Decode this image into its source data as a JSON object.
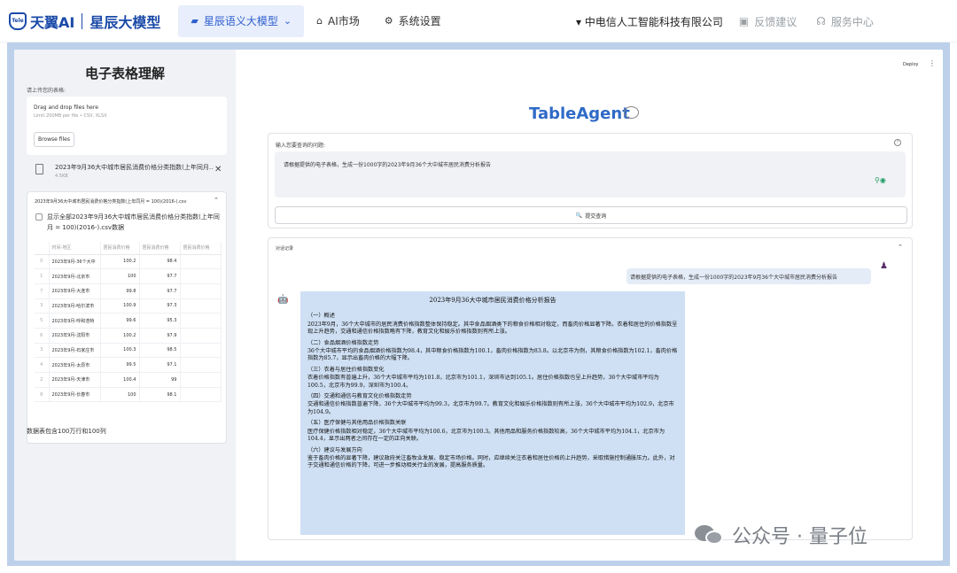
{
  "nav": {
    "brand": "天翼AI",
    "brand2": "星辰大模型",
    "active_tab": "星辰语义大模型",
    "tabs": [
      "AI市场",
      "系统设置"
    ],
    "company": "中电信人工智能科技有限公司",
    "links": [
      "反馈建议",
      "服务中心"
    ]
  },
  "sidebar": {
    "title": "电子表格理解",
    "prompt": "请上传您的表格:",
    "uploader": {
      "drag_text": "Drag and drop files here",
      "limit_text": "Limit 200MB per file • CSV, XLSX",
      "browse_label": "Browse files"
    },
    "file": {
      "name": "2023年9月36大中城市居民消费价格分类指数(上年同月...",
      "size": "4.5KB"
    },
    "expander": {
      "title": "2023年9月36大中城市居民消费价格分类指数(上年同月 = 100)(2016-).csv",
      "checkbox_label": "显示全部2023年9月36大中城市居民消费价格分类指数(上年同月 = 100)(2016-).csv数据"
    },
    "table": {
      "columns": [
        "",
        "时间-地区",
        "居民消费价格",
        "居民消费价格",
        "居民消费价格"
      ],
      "rows": [
        [
          "0",
          "2023年9月-36个大中",
          "100.2",
          "98.4",
          ""
        ],
        [
          "1",
          "2023年9月-北京市",
          "100",
          "97.7",
          ""
        ],
        [
          "7",
          "2023年9月-大连市",
          "99.8",
          "97.7",
          ""
        ],
        [
          "3",
          "2023年9月-哈尔滨市",
          "100.9",
          "97.3",
          ""
        ],
        [
          "5",
          "2023年9月-呼和浩特",
          "99.6",
          "95.3",
          ""
        ],
        [
          "6",
          "2023年9月-沈阳市",
          "100.2",
          "97.9",
          ""
        ],
        [
          "3",
          "2023年9月-石家庄市",
          "100.3",
          "98.5",
          ""
        ],
        [
          "4",
          "2023年9月-太原市",
          "99.5",
          "97.1",
          ""
        ],
        [
          "2",
          "2023年9月-天津市",
          "100.4",
          "99",
          ""
        ],
        [
          "8",
          "2023年9月-长春市",
          "100",
          "98.1",
          ""
        ]
      ]
    },
    "stats": "数据表包含100万行和100列"
  },
  "main": {
    "deploy_label": "Deploy",
    "kebab": "⋮",
    "title": "TableAgent",
    "question_label": "输入您要查询的问题:",
    "question_value": "请根据提供的电子表格，生成一份1000字的2023年9月36个大中城市居民消费分析报告",
    "submit_label": "提交查询",
    "chat_label": "对话记录",
    "user_message": "请根据提供的电子表格，生成一份1000字的2023年9月36个大中城市居民消费分析报告",
    "report": {
      "title": "2023年9月36大中城市居民消费价格分析报告",
      "sections": [
        {
          "heading": "（一）概述",
          "body": "2023年9月，36个大中城市的居民消费价格指数整体保持稳定。其中食品烟酒类下的粮食价格相对稳定，而畜肉价格显著下降。衣着和居住的价格指数呈现上升趋势，交通和通信价格指数略有下降，教育文化和娱乐价格指数则有所上涨。"
        },
        {
          "heading": "（二）食品烟酒价格指数走势",
          "body": "36个大中城市平均的食品烟酒价格指数为98.4，其中粮食价格指数为100.1，畜肉价格指数为83.8。以北京市为例，其粮食价格指数为102.1，畜肉价格指数为85.7，显示出畜肉价格的大幅下降。"
        },
        {
          "heading": "（三）衣着与居住价格指数变化",
          "body": "衣着价格指数有普遍上升，36个大中城市平均为101.8，北京市为101.1，深圳市达到105.1。居住价格指数也呈上升趋势，36个大中城市平均为100.5，北京市为99.9，深圳市为100.4。"
        },
        {
          "heading": "（四）交通和通信与教育文化价格指数走势",
          "body": "交通和通信价格指数普遍下降，36个大中城市平均为99.3，北京市为99.7。教育文化和娱乐价格指数则有所上涨，36个大中城市平均为102.9，北京市为104.9。"
        },
        {
          "heading": "（五）医疗保健与其他用品价格指数关联",
          "body": "医疗保健价格指数相对稳定，36个大中城市平均为100.6，北京市为100.3。其他用品和服务价格指数较高，36个大中城市平均为104.1，北京市为104.4，显示出两者之间存在一定的正向关联。"
        },
        {
          "heading": "（六）建议与发展方向",
          "body": "鉴于畜肉价格的显著下降，建议政府关注畜牧业发展，稳定市场价格。同时，应继续关注衣着和居住价格的上升趋势，采取措施控制通胀压力。此外，对于交通和通信价格的下降，可进一步推动相关行业的发展，提高服务质量。"
        }
      ]
    }
  },
  "watermark": "公众号 · 量子位",
  "colors": {
    "brand_blue": "#1a4aa8",
    "title_blue": "#2f6ac7",
    "frame_bg": "#bcd0ea",
    "report_bg": "#cfe0f4"
  }
}
